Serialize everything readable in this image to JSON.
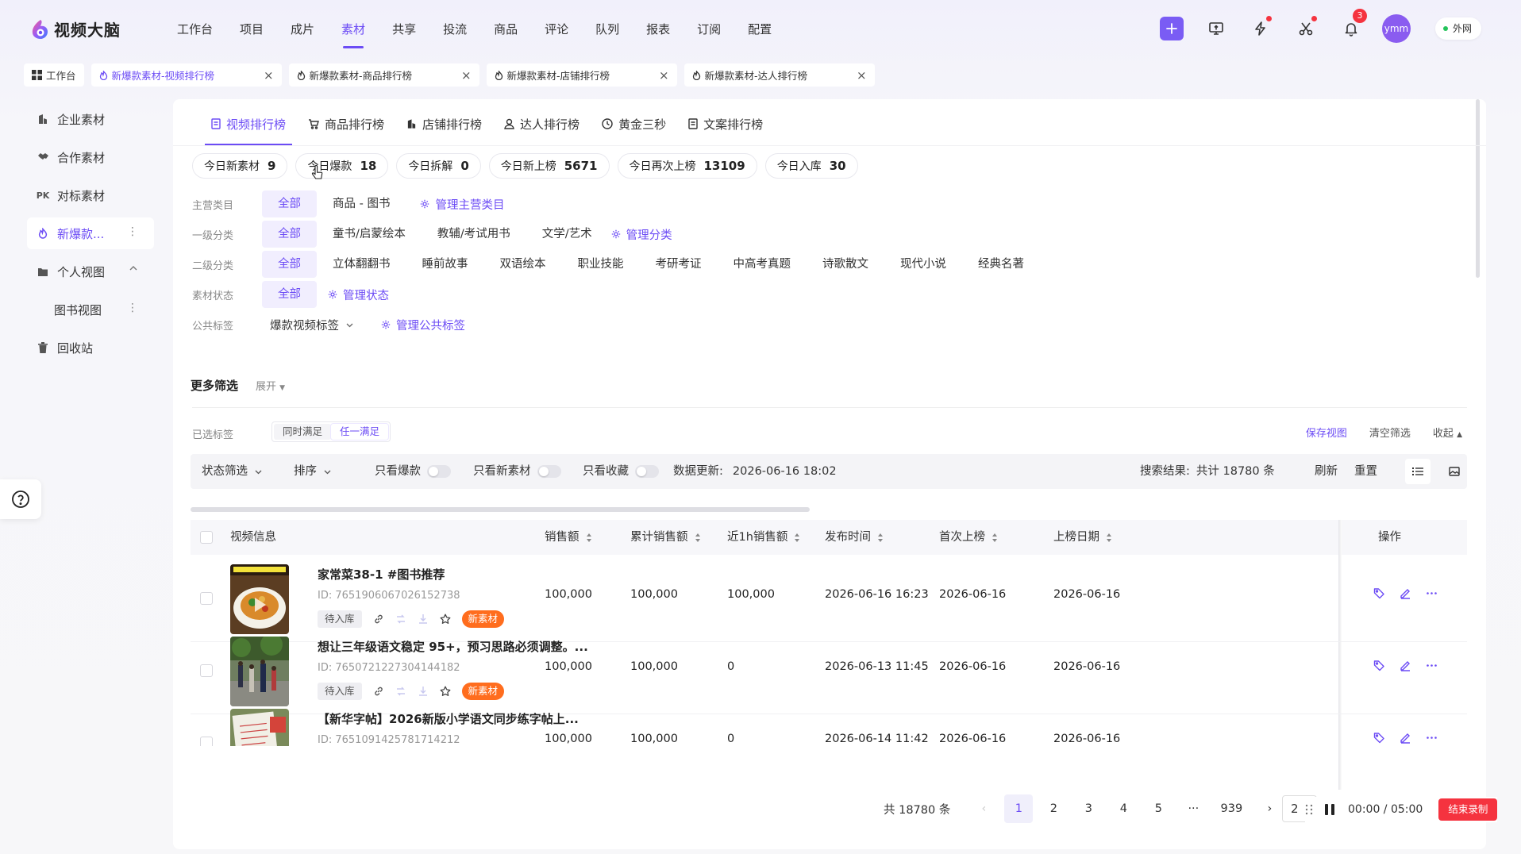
{
  "app": {
    "name": "视频大脑"
  },
  "topnav": [
    {
      "label": "工作台"
    },
    {
      "label": "项目"
    },
    {
      "label": "成片"
    },
    {
      "label": "素材",
      "active": true
    },
    {
      "label": "共享"
    },
    {
      "label": "投流"
    },
    {
      "label": "商品"
    },
    {
      "label": "评论"
    },
    {
      "label": "队列"
    },
    {
      "label": "报表"
    },
    {
      "label": "订阅"
    },
    {
      "label": "配置"
    }
  ],
  "header": {
    "notif_count": "3",
    "avatar": "ymm",
    "network": "外网"
  },
  "page_tabs": {
    "home": "工作台",
    "tabs": [
      {
        "label": "新爆款素材-视频排行榜",
        "active": true
      },
      {
        "label": "新爆款素材-商品排行榜"
      },
      {
        "label": "新爆款素材-店铺排行榜"
      },
      {
        "label": "新爆款素材-达人排行榜"
      }
    ]
  },
  "sidebar": [
    {
      "label": "企业素材",
      "icon": "building-icon"
    },
    {
      "label": "合作素材",
      "icon": "handshake-icon"
    },
    {
      "label": "对标素材",
      "icon": "pk-icon"
    },
    {
      "label": "新爆款...",
      "icon": "fire-icon",
      "active": true
    },
    {
      "label": "个人视图",
      "icon": "folder-icon",
      "expanded": true
    },
    {
      "label": "图书视图",
      "icon": "",
      "sub": true
    },
    {
      "label": "回收站",
      "icon": "trash-icon"
    }
  ],
  "rank_tabs": [
    {
      "label": "视频排行榜",
      "icon": "doc-icon",
      "active": true
    },
    {
      "label": "商品排行榜",
      "icon": "cart-icon"
    },
    {
      "label": "店铺排行榜",
      "icon": "building-icon"
    },
    {
      "label": "达人排行榜",
      "icon": "person-icon"
    },
    {
      "label": "黄金三秒",
      "icon": "clock-icon"
    },
    {
      "label": "文案排行榜",
      "icon": "doc-icon"
    }
  ],
  "stats": [
    {
      "label": "今日新素材",
      "value": "9"
    },
    {
      "label": "今日爆款",
      "value": "18"
    },
    {
      "label": "今日拆解",
      "value": "0"
    },
    {
      "label": "今日新上榜",
      "value": "5671"
    },
    {
      "label": "今日再次上榜",
      "value": "13109"
    },
    {
      "label": "今日入库",
      "value": "30"
    }
  ],
  "filters": {
    "main_category": {
      "label": "主营类目",
      "all": "全部",
      "items": [
        "商品 - 图书"
      ],
      "manage": "管理主营类目"
    },
    "level1": {
      "label": "一级分类",
      "all": "全部",
      "items": [
        "童书/启蒙绘本",
        "教辅/考试用书",
        "文学/艺术"
      ],
      "manage": "管理分类"
    },
    "level2": {
      "label": "二级分类",
      "all": "全部",
      "items": [
        "立体翻翻书",
        "睡前故事",
        "双语绘本",
        "职业技能",
        "考研考证",
        "中高考真题",
        "诗歌散文",
        "现代小说",
        "经典名著"
      ]
    },
    "status": {
      "label": "素材状态",
      "all": "全部",
      "manage": "管理状态"
    },
    "public_tags": {
      "label": "公共标签",
      "dropdown": "爆款视频标签",
      "manage": "管理公共标签"
    }
  },
  "more_filter": {
    "title": "更多筛选",
    "expand": "展开"
  },
  "selected_tags": {
    "label": "已选标签",
    "opt_all": "同时满足",
    "opt_any": "任一满足",
    "save_view": "保存视图",
    "clear": "清空筛选",
    "collapse": "收起"
  },
  "toolbar": {
    "status_filter": "状态筛选",
    "sort": "排序",
    "only_hot": "只看爆款",
    "only_new": "只看新素材",
    "only_fav": "只看收藏",
    "updated_label": "数据更新:",
    "updated_value": "2026-06-16 18:02",
    "result_label": "搜索结果:",
    "result_value": "共计 18780 条",
    "refresh": "刷新",
    "reset": "重置"
  },
  "table": {
    "headers": {
      "video": "视频信息",
      "sales": "销售额",
      "cum_sales": "累计销售额",
      "sales_1h": "近1h销售额",
      "publish": "发布时间",
      "first": "首次上榜",
      "date": "上榜日期",
      "ops": "操作"
    },
    "rows": [
      {
        "title": "家常菜38-1 #图书推荐",
        "id": "ID: 7651906067026152738",
        "status": "待入库",
        "tag": "新素材",
        "sales": "100,000",
        "cum_sales": "100,000",
        "sales_1h": "100,000",
        "publish": "2026-06-16 16:23",
        "first": "2026-06-16",
        "date": "2026-06-16"
      },
      {
        "title": "想让三年级语文稳定 95+，预习思路必须调整。...",
        "id": "ID: 7650721227304144182",
        "status": "待入库",
        "tag": "新素材",
        "sales": "100,000",
        "cum_sales": "100,000",
        "sales_1h": "0",
        "publish": "2026-06-13 11:45",
        "first": "2026-06-16",
        "date": "2026-06-16"
      },
      {
        "title": "【新华字帖】2026新版小学语文同步练字帖上...",
        "id": "ID: 7651091425781714212",
        "status": "",
        "tag": "",
        "sales": "100,000",
        "cum_sales": "100,000",
        "sales_1h": "0",
        "publish": "2026-06-14 11:42",
        "first": "2026-06-16",
        "date": "2026-06-16"
      }
    ]
  },
  "pagination": {
    "total": "共 18780 条",
    "pages": [
      "1",
      "2",
      "3",
      "4",
      "5",
      "···",
      "939"
    ],
    "current": "1",
    "size": "2"
  },
  "recorder": {
    "time": "00:00 / 05:00",
    "end": "结束录制"
  },
  "colors": {
    "accent": "#6c4cf5",
    "new_tag": "#ff6d1e",
    "danger": "#f5333f"
  }
}
